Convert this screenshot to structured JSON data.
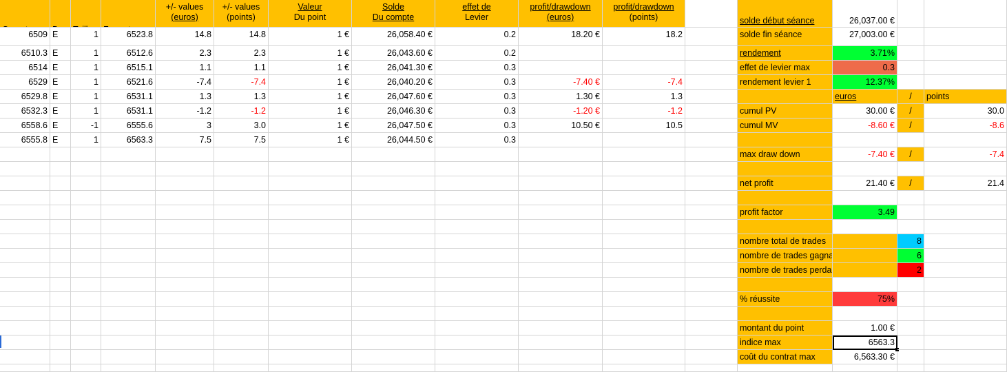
{
  "headers": [
    {
      "l1": "",
      "l2": "Ouverture"
    },
    {
      "l1": "",
      "l2": "Dev"
    },
    {
      "l1": "",
      "l2": "Taille"
    },
    {
      "l1": "",
      "l2": "Fermeture"
    },
    {
      "l1": "+/- values",
      "l2": "(euros)"
    },
    {
      "l1": "+/- values",
      "l2": "(points)"
    },
    {
      "l1": "Valeur",
      "l2": "Du point"
    },
    {
      "l1": "Solde",
      "l2": "Du compte"
    },
    {
      "l1": "effet de",
      "l2": "Levier"
    },
    {
      "l1": "profit/drawdown",
      "l2": "(euros)"
    },
    {
      "l1": "profit/drawdown",
      "l2": "(points)"
    }
  ],
  "rows": [
    [
      "6509",
      "E",
      "1",
      "6523.8",
      "14.8",
      "14.8",
      "1 €",
      "26,058.40 €",
      "0.2",
      "18.20 €",
      "18.2"
    ],
    [
      "6510.3",
      "E",
      "1",
      "6512.6",
      "2.3",
      "2.3",
      "1 €",
      "26,043.60 €",
      "0.2",
      "",
      ""
    ],
    [
      "6514",
      "E",
      "1",
      "6515.1",
      "1.1",
      "1.1",
      "1 €",
      "26,041.30 €",
      "0.3",
      "",
      ""
    ],
    [
      "6529",
      "E",
      "1",
      "6521.6",
      "-7.4",
      "-7.4",
      "1 €",
      "26,040.20 €",
      "0.3",
      "-7.40 €",
      "-7.4"
    ],
    [
      "6529.8",
      "E",
      "1",
      "6531.1",
      "1.3",
      "1.3",
      "1 €",
      "26,047.60 €",
      "0.3",
      "1.30 €",
      "1.3"
    ],
    [
      "6532.3",
      "E",
      "1",
      "6531.1",
      "-1.2",
      "-1.2",
      "1 €",
      "26,046.30 €",
      "0.3",
      "-1.20 €",
      "-1.2"
    ],
    [
      "6558.6",
      "E",
      "-1",
      "6555.6",
      "3",
      "3.0",
      "1 €",
      "26,047.50 €",
      "0.3",
      "10.50 €",
      "10.5"
    ],
    [
      "6555.8",
      "E",
      "1",
      "6563.3",
      "7.5",
      "7.5",
      "1 €",
      "26,044.50 €",
      "0.3",
      "",
      ""
    ]
  ],
  "summary": {
    "solde_debut_label": "solde début séance",
    "solde_debut_value": "26,037.00 €",
    "solde_fin_label": "solde fin séance",
    "solde_fin_value": "27,003.00 €",
    "rendement_label": "rendement",
    "rendement_value": "3.71%",
    "effet_levier_max_label": "effet de levier max",
    "effet_levier_max_value": "0.3",
    "rendement_levier_label": "rendement levier 1",
    "rendement_levier_value": "12.37%",
    "euros_label": "euros",
    "slash": "/",
    "points_label": "points",
    "cumul_pv_label": "cumul PV",
    "cumul_pv_euros": "30.00 €",
    "cumul_pv_points": "30.0",
    "cumul_mv_label": "cumul MV",
    "cumul_mv_euros": "-8.60 €",
    "cumul_mv_points": "-8.6",
    "max_dd_label": "max draw down",
    "max_dd_euros": "-7.40 €",
    "max_dd_points": "-7.4",
    "net_profit_label": "net profit",
    "net_profit_euros": "21.40 €",
    "net_profit_points": "21.4",
    "profit_factor_label": "profit factor",
    "profit_factor_value": "3.49",
    "nb_total_label": "nombre total de trades",
    "nb_total_value": "8",
    "nb_gagnants_label": "nombre de trades gagnants",
    "nb_gagnants_value": "6",
    "nb_perdants_label": "nombre de trades perdants",
    "nb_perdants_value": "2",
    "reussite_label": "% réussite",
    "reussite_value": "75%",
    "montant_point_label": "montant du point",
    "montant_point_value": "1.00 €",
    "indice_max_label": "indice max",
    "indice_max_value": "6563.3",
    "cout_contrat_label": "coût du contrat max",
    "cout_contrat_value": "6,563.30 €"
  },
  "colors": {
    "header_orange": "#ffc000",
    "positive_green": "#00ff33",
    "negative_red": "#ff0000",
    "cyan": "#00ccff",
    "tomato": "#ee6b4a",
    "light_red": "#ff3b3b"
  }
}
